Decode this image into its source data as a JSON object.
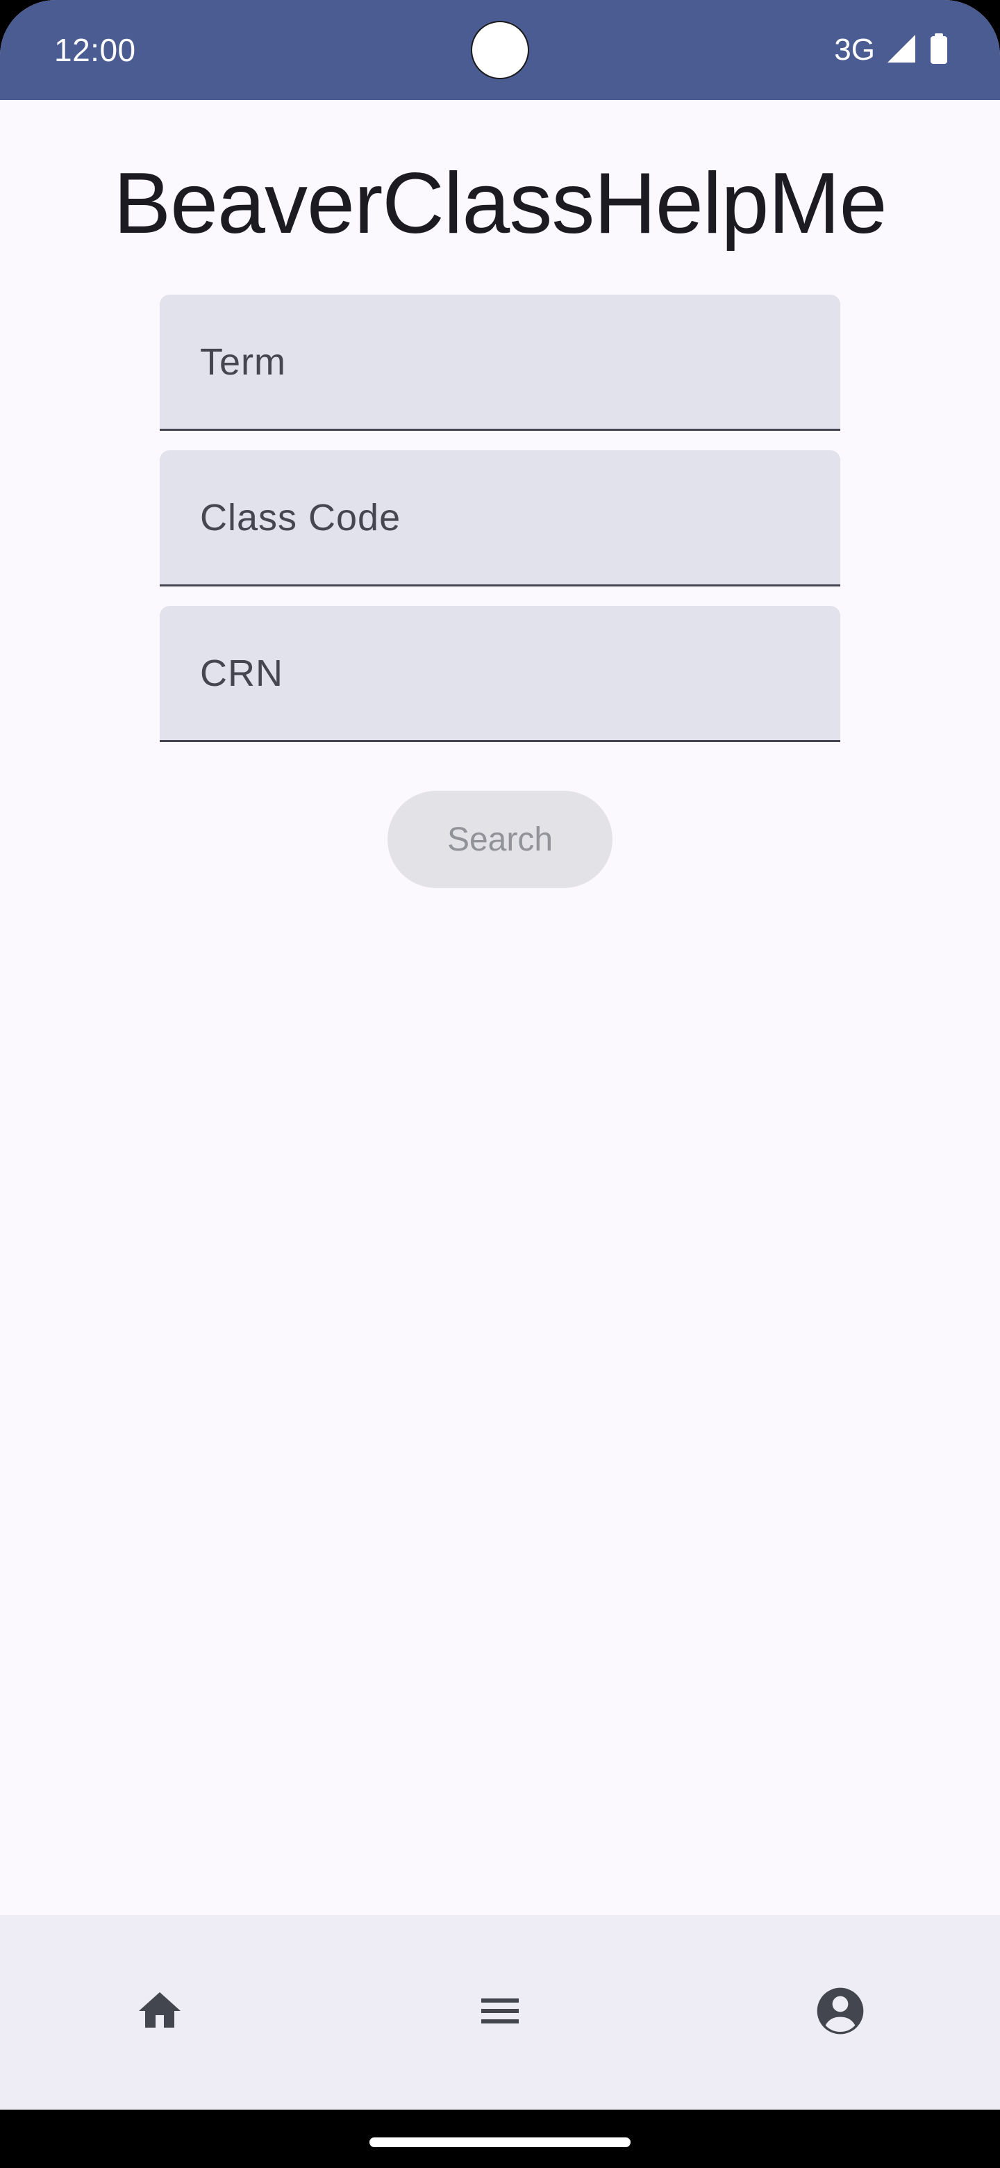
{
  "status_bar": {
    "time": "12:00",
    "network": "3G",
    "icons": [
      "signal-icon",
      "battery-icon"
    ]
  },
  "app": {
    "title": "BeaverClassHelpMe"
  },
  "form": {
    "term": {
      "placeholder": "Term",
      "value": ""
    },
    "class_code": {
      "placeholder": "Class Code",
      "value": ""
    },
    "crn": {
      "placeholder": "CRN",
      "value": ""
    },
    "search_label": "Search",
    "search_enabled": false
  },
  "bottom_nav": {
    "items": [
      {
        "icon": "home-icon"
      },
      {
        "icon": "menu-icon"
      },
      {
        "icon": "account-circle-icon"
      }
    ]
  },
  "colors": {
    "status_bar": "#4a5c91",
    "background": "#fcf9fe",
    "field_fill": "#e1e2ec",
    "nav_background": "#eeedf6",
    "icon": "#44464f"
  }
}
